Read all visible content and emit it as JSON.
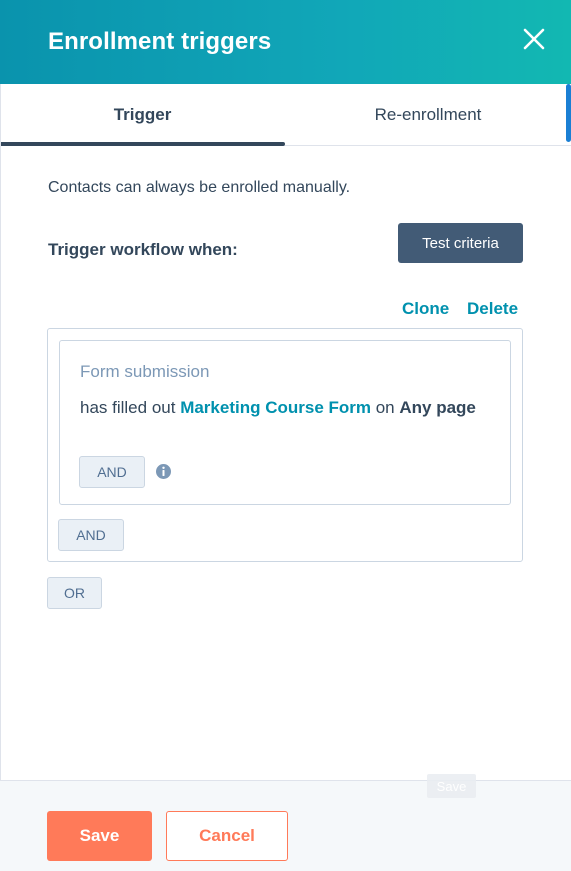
{
  "header": {
    "title": "Enrollment triggers",
    "close_icon": "close-icon"
  },
  "tabs": [
    {
      "label": "Trigger",
      "active": true
    },
    {
      "label": "Re-enrollment",
      "active": false
    }
  ],
  "body": {
    "info_text": "Contacts can always be enrolled manually.",
    "trigger_label": "Trigger workflow when:",
    "test_button": "Test criteria",
    "clone_link": "Clone",
    "delete_link": "Delete"
  },
  "filter": {
    "type": "Form submission",
    "prefix": "has filled out ",
    "form_name": "Marketing Course Form",
    "middle": " on ",
    "page": "Any page",
    "and_inner": "AND",
    "info_icon": "info-icon"
  },
  "group": {
    "and_outer": "AND",
    "or": "OR"
  },
  "footer": {
    "ghost_save": "Save",
    "save": "Save",
    "cancel": "Cancel"
  },
  "colors": {
    "header_start": "#0a93ad",
    "header_end": "#12b8b2",
    "primary_text": "#33475b",
    "link": "#0091ae",
    "save": "#ff7a59",
    "dark_button": "#425b76"
  }
}
